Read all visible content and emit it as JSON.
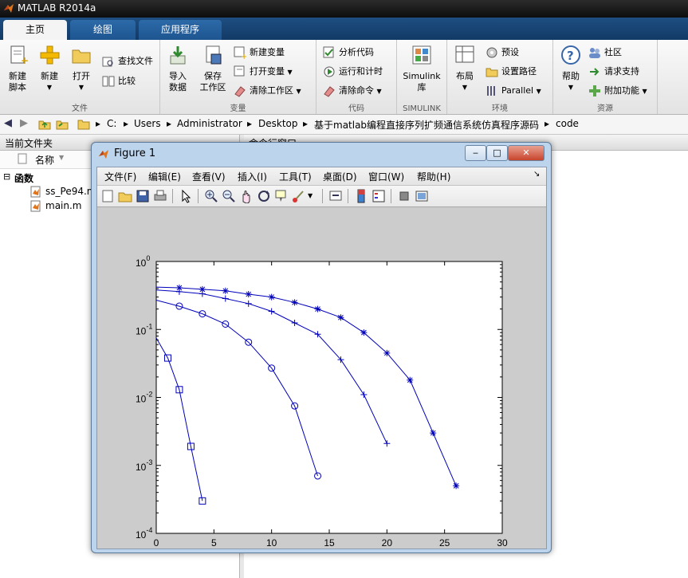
{
  "app": {
    "title": "MATLAB R2014a"
  },
  "tabs": [
    {
      "label": "主页",
      "active": true
    },
    {
      "label": "绘图",
      "active": false
    },
    {
      "label": "应用程序",
      "active": false
    }
  ],
  "ribbon": {
    "file": {
      "label": "文件",
      "new_script": [
        "新建",
        "脚本"
      ],
      "new": "新建",
      "open": "打开",
      "find_files": "查找文件",
      "compare": "比较"
    },
    "variable": {
      "label": "变量",
      "import": [
        "导入",
        "数据"
      ],
      "save": [
        "保存",
        "工作区"
      ],
      "new_var": "新建变量",
      "open_var": "打开变量",
      "clear_ws": "清除工作区"
    },
    "code": {
      "label": "代码",
      "analyze": "分析代码",
      "run_time": "运行和计时",
      "clear_cmd": "清除命令"
    },
    "simulink": {
      "label": "SIMULINK",
      "btn": [
        "Simulink",
        "库"
      ]
    },
    "env": {
      "label": "环境",
      "layout": "布局",
      "prefs": "预设",
      "setpath": "设置路径",
      "parallel": "Parallel"
    },
    "resources": {
      "label": "资源",
      "help": "帮助",
      "community": "社区",
      "support": "请求支持",
      "addons": "附加功能"
    }
  },
  "address": {
    "crumbs": [
      "C:",
      "Users",
      "Administrator",
      "Desktop",
      "基于matlab编程直接序列扩频通信系统仿真程序源码",
      "code"
    ]
  },
  "left_panel": {
    "title": "当前文件夹",
    "col_name": "名称",
    "section": "函数",
    "files": [
      "ss_Pe94.m",
      "main.m"
    ]
  },
  "command_window": {
    "title": "命令行窗口"
  },
  "figure": {
    "title": "Figure 1",
    "menus": [
      "文件(F)",
      "编辑(E)",
      "查看(V)",
      "插入(I)",
      "工具(T)",
      "桌面(D)",
      "窗口(W)",
      "帮助(H)"
    ],
    "buttons": {
      "min": "‒",
      "max": "□",
      "close": "✕"
    }
  },
  "colors": {
    "line": "#0000bb",
    "matlab_blue": "#1e4e82"
  },
  "chart_data": {
    "type": "line",
    "title": "",
    "xlabel": "",
    "ylabel": "",
    "xlim": [
      0,
      30
    ],
    "ylim": [
      0.0001,
      1
    ],
    "yscale": "log",
    "xticks": [
      "0",
      "5",
      "10",
      "15",
      "20",
      "25",
      "30"
    ],
    "yticks": [
      {
        "base": "10",
        "exp": "0"
      },
      {
        "base": "10",
        "exp": "-1"
      },
      {
        "base": "10",
        "exp": "-2"
      },
      {
        "base": "10",
        "exp": "-3"
      },
      {
        "base": "10",
        "exp": "-4"
      }
    ],
    "grid": false,
    "series": [
      {
        "marker": "square",
        "x": [
          0,
          1,
          2,
          3,
          4
        ],
        "y": [
          0.075,
          0.038,
          0.013,
          0.0019,
          0.0003
        ]
      },
      {
        "marker": "circle",
        "x": [
          0,
          2,
          4,
          6,
          8,
          10,
          12,
          14
        ],
        "y": [
          0.27,
          0.22,
          0.17,
          0.12,
          0.065,
          0.027,
          0.0075,
          0.0007
        ]
      },
      {
        "marker": "plus",
        "x": [
          0,
          2,
          4,
          6,
          8,
          10,
          12,
          14,
          16,
          18,
          20
        ],
        "y": [
          0.38,
          0.36,
          0.335,
          0.285,
          0.24,
          0.185,
          0.125,
          0.085,
          0.036,
          0.011,
          0.0021
        ]
      },
      {
        "marker": "star",
        "x": [
          0,
          2,
          4,
          6,
          8,
          10,
          12,
          14,
          16,
          18,
          20,
          22,
          24,
          26
        ],
        "y": [
          0.42,
          0.41,
          0.39,
          0.37,
          0.33,
          0.3,
          0.25,
          0.2,
          0.15,
          0.09,
          0.045,
          0.018,
          0.003,
          0.0005
        ]
      }
    ]
  }
}
